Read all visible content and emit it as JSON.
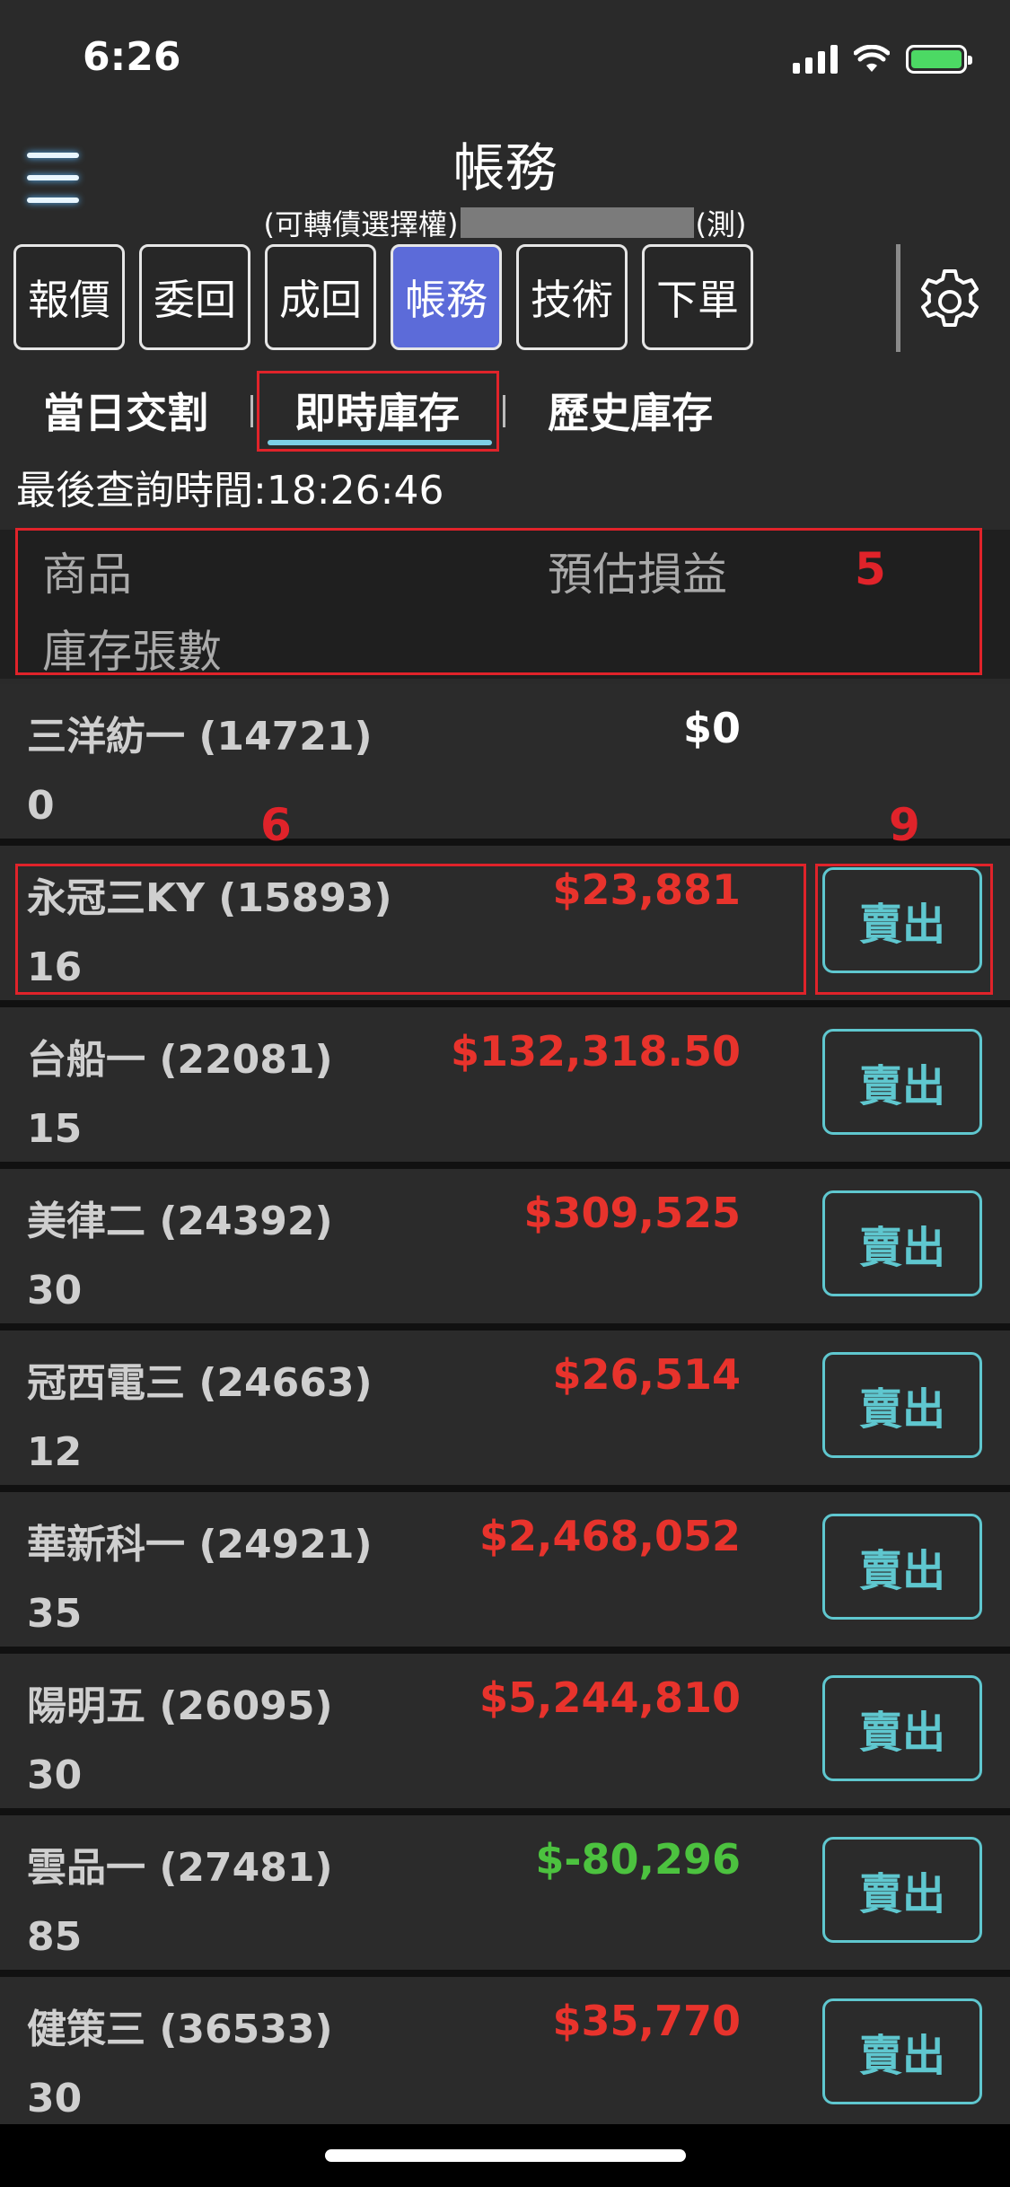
{
  "status_bar": {
    "time": "6:26"
  },
  "header": {
    "title": "帳務",
    "subtitle_prefix": "(可轉債選擇權)",
    "subtitle_suffix": "(測)"
  },
  "tabs": [
    {
      "label": "報價"
    },
    {
      "label": "委回"
    },
    {
      "label": "成回"
    },
    {
      "label": "帳務",
      "active": true
    },
    {
      "label": "技術"
    },
    {
      "label": "下單"
    }
  ],
  "subtabs": [
    {
      "label": "當日交割"
    },
    {
      "label": "即時庫存",
      "active": true
    },
    {
      "label": "歷史庫存"
    }
  ],
  "query_time": "最後查詢時間:18:26:46",
  "columns": {
    "product": "商品",
    "pnl": "預估損益",
    "qty": "庫存張數"
  },
  "annotations": {
    "a5": "5",
    "a6": "6",
    "a9": "9"
  },
  "colors": {
    "profit": "#e8332c",
    "loss": "#4cc23f",
    "neutral": "#ffffff",
    "accent": "#5c6bd9",
    "sell": "#5fc7cf"
  },
  "holdings": [
    {
      "name": "三洋紡一 (14721)",
      "pnl": "$0",
      "qty": "0",
      "tone": "neutral",
      "sell": ""
    },
    {
      "name": "永冠三KY (15893)",
      "pnl": "$23,881",
      "qty": "16",
      "tone": "profit",
      "sell": "賣出"
    },
    {
      "name": "台船一 (22081)",
      "pnl": "$132,318.50",
      "qty": "15",
      "tone": "profit",
      "sell": "賣出"
    },
    {
      "name": "美律二 (24392)",
      "pnl": "$309,525",
      "qty": "30",
      "tone": "profit",
      "sell": "賣出"
    },
    {
      "name": "冠西電三 (24663)",
      "pnl": "$26,514",
      "qty": "12",
      "tone": "profit",
      "sell": "賣出"
    },
    {
      "name": "華新科一 (24921)",
      "pnl": "$2,468,052",
      "qty": "35",
      "tone": "profit",
      "sell": "賣出"
    },
    {
      "name": "陽明五 (26095)",
      "pnl": "$5,244,810",
      "qty": "30",
      "tone": "profit",
      "sell": "賣出"
    },
    {
      "name": "雲品一 (27481)",
      "pnl": "$-80,296",
      "qty": "85",
      "tone": "loss",
      "sell": "賣出"
    },
    {
      "name": "健策三 (36533)",
      "pnl": "$35,770",
      "qty": "30",
      "tone": "profit",
      "sell": "賣出"
    }
  ]
}
